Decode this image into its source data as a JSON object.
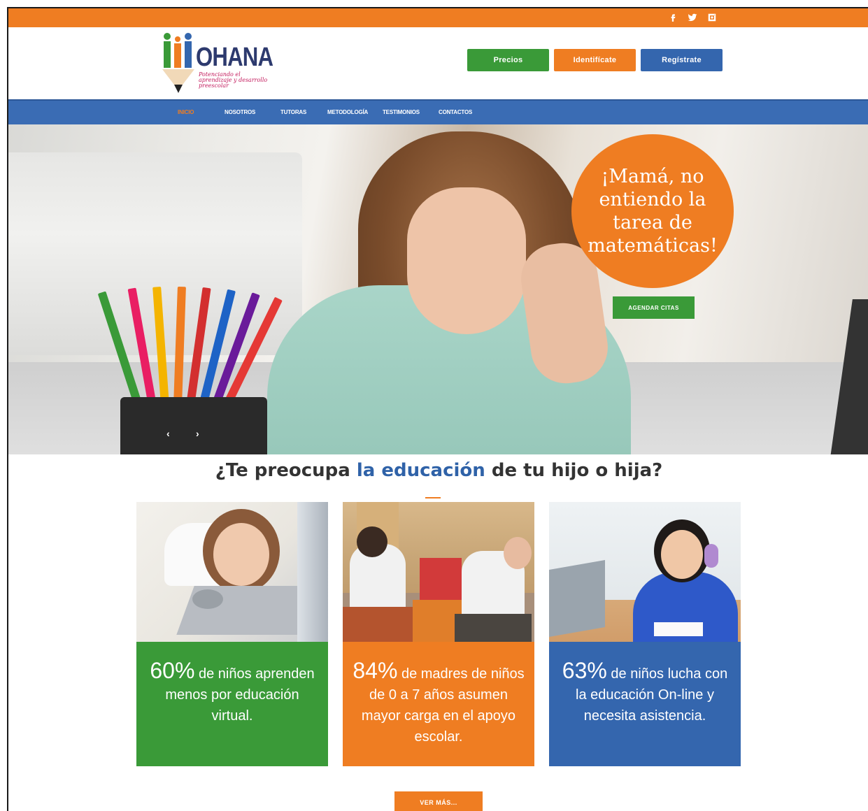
{
  "social": {
    "icons": [
      "facebook-icon",
      "twitter-icon",
      "instagram-icon"
    ]
  },
  "brand": {
    "name": "OHANA",
    "tagline": "Potenciando el aprendizaje y desarrollo preescolar"
  },
  "header_buttons": {
    "precios": "Precios",
    "identificate": "Identifícate",
    "registrate": "Regístrate"
  },
  "nav": {
    "items": [
      "INICIO",
      "NOSOTROS",
      "TUTORAS",
      "METODOLOGÍA",
      "TESTIMONIOS",
      "CONTACTOS"
    ],
    "active": "INICIO"
  },
  "hero": {
    "bubble_text": "¡Mamá, no entiendo la tarea de matemáticas!",
    "cta": "AGENDAR CITAS",
    "prev": "‹",
    "next": "›"
  },
  "section": {
    "heading_pre": "¿Te preocupa ",
    "heading_highlight": "la educación",
    "heading_post": " de tu hijo o hija?",
    "cards": [
      {
        "pct": "60%",
        "text": " de niños aprenden menos por educación virtual.",
        "color": "#3a9a38"
      },
      {
        "pct": "84%",
        "text": " de madres de niños de 0 a 7 años asumen mayor carga en el apoyo escolar.",
        "color": "#ef7d22"
      },
      {
        "pct": "63%",
        "text": " de niños lucha con la educación On-line y necesita asistencia.",
        "color": "#3466ae"
      }
    ],
    "more_button": "VER MÁS..."
  },
  "colors": {
    "orange": "#ef7d22",
    "green": "#3a9a38",
    "blue": "#3466ae",
    "nav_blue": "#3a6cb4"
  }
}
